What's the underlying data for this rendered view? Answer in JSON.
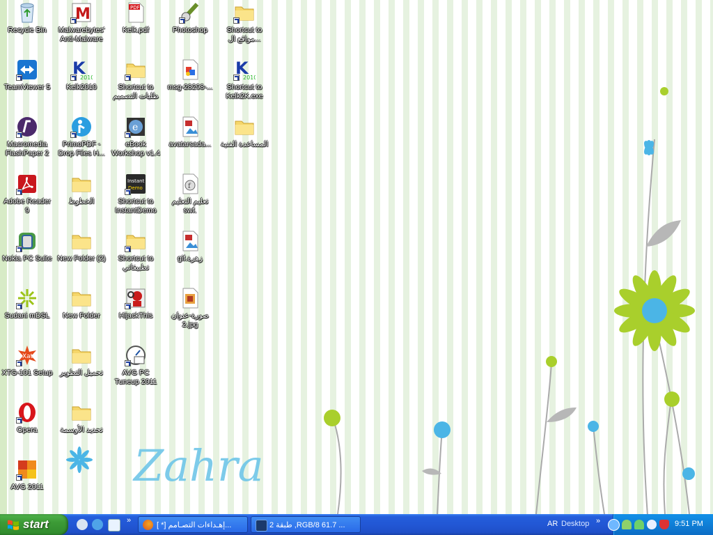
{
  "desktop": {
    "icons": [
      {
        "label": "Recycle Bin",
        "icon": "recycle-bin-icon"
      },
      {
        "label": "TeamViewer 5",
        "icon": "teamviewer-icon"
      },
      {
        "label": "Macromedia FlashPaper 2",
        "icon": "flashpaper-icon"
      },
      {
        "label": "Adobe Reader 9",
        "icon": "adobe-reader-icon"
      },
      {
        "label": "Nokia PC Suite",
        "icon": "nokia-icon"
      },
      {
        "label": "Sudani mDSL",
        "icon": "sudani-icon"
      },
      {
        "label": "XTG-101 Setup",
        "icon": "xtg-icon"
      },
      {
        "label": "Opera",
        "icon": "opera-icon"
      },
      {
        "label": "AVG 2011",
        "icon": "avg-icon"
      },
      {
        "label": "Malwarebytes' Anti-Malware",
        "icon": "malwarebytes-icon"
      },
      {
        "label": "Kelk2010",
        "icon": "kelk-icon"
      },
      {
        "label": "PrimoPDF - Drop Files H...",
        "icon": "primopdf-icon"
      },
      {
        "label": "الخطوط",
        "icon": "folder-icon"
      },
      {
        "label": "New Folder (2)",
        "icon": "folder-icon"
      },
      {
        "label": "New Folder",
        "icon": "folder-icon"
      },
      {
        "label": "تحميل التطوير",
        "icon": "folder-icon"
      },
      {
        "label": "تحديد الأوسمة",
        "icon": "folder-icon"
      },
      {
        "label": "Kelk.pdf",
        "icon": "pdf-file-icon"
      },
      {
        "label": "Shortcut to طلبات التصميم",
        "icon": "folder-icon"
      },
      {
        "label": "eBook Workshop v1.4",
        "icon": "ebook-icon"
      },
      {
        "label": "Shortcut to InstantDemo",
        "icon": "instant-demo-icon"
      },
      {
        "label": "Shortcut to تطبيقاتي",
        "icon": "folder-icon"
      },
      {
        "label": "HijackThis",
        "icon": "hijackthis-icon"
      },
      {
        "label": "AVG PC Tuneup 2011",
        "icon": "avg-tuneup-icon"
      },
      {
        "label": "Photoshop",
        "icon": "photoshop-icon"
      },
      {
        "label": "msg-28298-...",
        "icon": "image-file-icon"
      },
      {
        "label": "avatarsada...",
        "icon": "image-file-icon"
      },
      {
        "label": "تعليم التعليم swf.",
        "icon": "swf-file-icon"
      },
      {
        "label": "gif.زهرة",
        "icon": "gif-file-icon"
      },
      {
        "label": "صورة-عنوان 2.jpg",
        "icon": "jpg-file-icon"
      },
      {
        "label": "Shortcut to مواقع ال...",
        "icon": "folder-icon"
      },
      {
        "label": "Shortcut to Kelk2K.exe",
        "icon": "kelk-icon"
      },
      {
        "label": "المساعدة الفنية",
        "icon": "folder-icon"
      }
    ],
    "wallpaper_text": "Zahra"
  },
  "taskbar": {
    "start_label": "start",
    "quick_launch": [
      "quick-launch-media-icon",
      "quick-launch-messenger-icon",
      "quick-launch-browser-icon"
    ],
    "tasks": [
      {
        "label": "[ *] إهـداءات التصـامم...",
        "icon": "firefox-icon"
      },
      {
        "label": "طبقة 2 ,RGB/8 61.7 ...",
        "icon": "photoshop-task-icon"
      }
    ],
    "language": "AR",
    "desktop_toolbar": "Desktop",
    "clock": "9:51 PM"
  }
}
